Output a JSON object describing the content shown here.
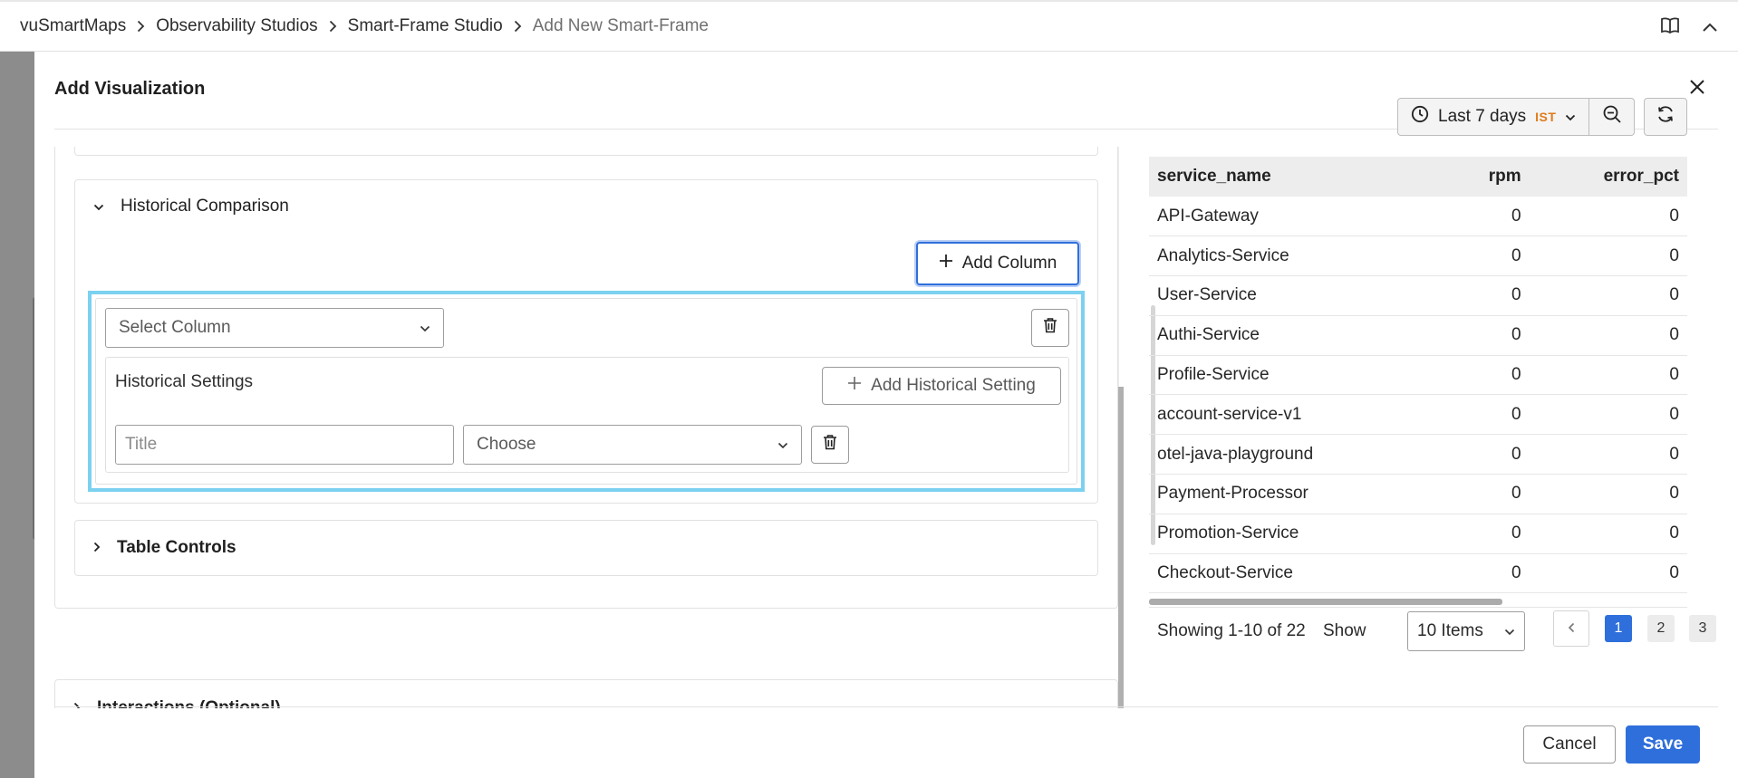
{
  "breadcrumb": {
    "items": [
      "vuSmartMaps",
      "Observability Studios",
      "Smart-Frame Studio"
    ],
    "current": "Add New Smart-Frame"
  },
  "icons": {
    "book": "book-icon",
    "collapse": "chevron-up-icon",
    "close": "close-icon",
    "clock": "clock-icon",
    "zoom_out": "zoom-out-icon",
    "refresh": "refresh-icon",
    "trash": "trash-icon"
  },
  "modal": {
    "title": "Add Visualization"
  },
  "historical_comparison": {
    "title": "Historical Comparison",
    "add_column_label": "Add Column",
    "select_column_placeholder": "Select Column",
    "historical_settings_label": "Historical Settings",
    "add_historical_setting_label": "Add Historical Setting",
    "title_placeholder": "Title",
    "choose_placeholder": "Choose"
  },
  "sections": {
    "table_controls": "Table Controls",
    "interactions": "Interactions (Optional)"
  },
  "preview": {
    "time_range": "Last 7 days",
    "timezone": "IST",
    "table": {
      "columns": [
        "service_name",
        "rpm",
        "error_pct"
      ],
      "rows": [
        [
          "API-Gateway",
          "0",
          "0"
        ],
        [
          "Analytics-Service",
          "0",
          "0"
        ],
        [
          "User-Service",
          "0",
          "0"
        ],
        [
          "Authi-Service",
          "0",
          "0"
        ],
        [
          "Profile-Service",
          "0",
          "0"
        ],
        [
          "account-service-v1",
          "0",
          "0"
        ],
        [
          "otel-java-playground",
          "0",
          "0"
        ],
        [
          "Payment-Processor",
          "0",
          "0"
        ],
        [
          "Promotion-Service",
          "0",
          "0"
        ],
        [
          "Checkout-Service",
          "0",
          "0"
        ]
      ]
    },
    "pagination": {
      "showing": "Showing 1-10 of 22",
      "show_label": "Show",
      "page_size": "10 Items",
      "pages": [
        "1",
        "2",
        "3"
      ],
      "active_page": "1"
    }
  },
  "footer": {
    "cancel_label": "Cancel",
    "save_label": "Save"
  },
  "colors": {
    "primary": "#2f6fdb",
    "selection_outline": "#7cd1f0",
    "timezone_badge": "#e07b1a"
  }
}
